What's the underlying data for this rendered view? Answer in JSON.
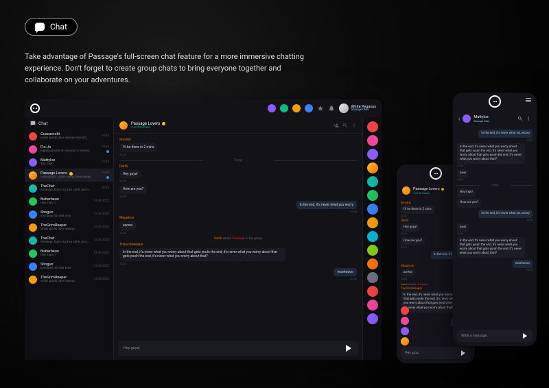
{
  "header": {
    "pill_label": "Chat"
  },
  "description": "Take advantage of Passage's full-screen chat feature for a more immersive chatting experience. Don't forget to create group chats to bring everyone together and collaborate on your adventures.",
  "desktop": {
    "top_user": {
      "name": "White Pegasus",
      "sub": "Strange Clan"
    },
    "sidebar": {
      "title": "Chat",
      "rows": [
        {
          "name": "Guacamolti",
          "sub": "Great spirits have always encount…",
          "time": "14:04",
          "ava": "c0",
          "unread": false
        },
        {
          "name": "Flo-Jo",
          "sub": "Eighty percent of success is showin…",
          "time": "14:04",
          "ava": "c9",
          "unread": true
        },
        {
          "name": "MattyIce",
          "sub": "You: Hey!",
          "time": "14:04",
          "ava": "c8",
          "unread": false
        },
        {
          "name": "Passage Lovers",
          "sub": "Guacamolti: Great spirits have alway…",
          "time": "14:04",
          "ava": "c11",
          "unread": true,
          "verified": true,
          "selected": true
        },
        {
          "name": "TheChef",
          "sub": "Anyways, that's my two cents plot t…",
          "time": "14:04",
          "ava": "c5",
          "unread": false
        },
        {
          "name": "Butterbean",
          "sub": "Hey man! :)",
          "time": "13.08.2022",
          "ava": "c4",
          "unread": false
        },
        {
          "name": "Shogun",
          "sub": "Init ideas for next time",
          "time": "13.08.2022",
          "ava": "c7",
          "unread": false
        },
        {
          "name": "TheGrimReaper",
          "sub": "Great spirits have always…",
          "time": "13.08.2022",
          "ava": "c2",
          "unread": false
        },
        {
          "name": "TheChef",
          "sub": "Anyways, that's my two cents plot t…",
          "time": "13.08.2022",
          "ava": "c5",
          "unread": false
        },
        {
          "name": "Butterbean",
          "sub": "Hey man! :)",
          "time": "13.08.2022",
          "ava": "c4",
          "unread": false
        },
        {
          "name": "Shogun",
          "sub": "Init ideas for next time",
          "time": "13.08.2022",
          "ava": "c7",
          "unread": false
        },
        {
          "name": "TheGrimReaper",
          "sub": "Great spirits have always…",
          "time": "13.08.2022",
          "ava": "c2",
          "unread": false
        }
      ]
    },
    "chat": {
      "title": "Passage Lovers",
      "sub": "4 of 20 Online",
      "stream": [
        {
          "kind": "msg",
          "author": "Smokin",
          "text": "I'll be there in 2 mins",
          "time": "22:03"
        },
        {
          "kind": "divider",
          "label": "Today"
        },
        {
          "kind": "msg",
          "author": "Darth",
          "text": "Hey guys!",
          "time": "22:03"
        },
        {
          "kind": "msg-cont",
          "text": "How are you?",
          "time": "22:03"
        },
        {
          "kind": "mine",
          "text": "In the end, it's never what you worry",
          "time": "22:03"
        },
        {
          "kind": "msg",
          "author": "Megatron",
          "text": "awww",
          "time": "22:03"
        },
        {
          "kind": "sys",
          "u1": "Darth",
          "verb": "added",
          "u2": "TheHawk",
          "trail": "to the group"
        },
        {
          "kind": "msg",
          "author": "TheGrimReaper",
          "text": "In the end, it's never what you worry about that gets youIn the end, it's never what you worry about that gets youIn the end, it's never what you worry about that?",
          "time": "22:03"
        },
        {
          "kind": "mine",
          "text": "woohoooo",
          "time": "22:03"
        }
      ],
      "input_value": "Hey guys",
      "input_cursor": "|"
    },
    "rail_avatars": [
      "c0",
      "c9",
      "c8",
      "c11",
      "c5",
      "c4",
      "c7",
      "c2",
      "c6",
      "c3",
      "c1",
      "c10",
      "c0",
      "c9",
      "c8"
    ]
  },
  "phone_left": {
    "title": "Passage Lovers",
    "sub": "4 of 20 Online",
    "stream": [
      {
        "kind": "msg",
        "author": "Smokin",
        "text": "I'll be there in 2 mins",
        "time": "22:03"
      },
      {
        "kind": "msg",
        "author": "Darth",
        "text": "Hey guys!",
        "time": "22:03"
      },
      {
        "kind": "msg-cont",
        "text": "How are you?",
        "time": "22:03"
      },
      {
        "kind": "mine",
        "text": "In the end, it's never what",
        "time": "22:03"
      },
      {
        "kind": "msg",
        "author": "Megatron",
        "text": "awww",
        "time": "22:03"
      },
      {
        "kind": "sys",
        "u1": "Darth",
        "verb": "added",
        "u2": "TheHawk",
        "trail": ""
      },
      {
        "kind": "msg",
        "author": "TheGrimReaper",
        "text": "In the end, it's never what you worry about that gets youIn the end, it's never what you worry about that gets youIn the end, it's never what you worry about that?",
        "time": "22:03"
      },
      {
        "kind": "mine",
        "text": "woohoooo",
        "time": "22:03"
      }
    ],
    "input_value": "Hey guys",
    "rail_avatars": [
      "c0",
      "c9",
      "c8",
      "c11"
    ],
    "rail_avatars_r": [
      "c5",
      "c7",
      "c3",
      "c11"
    ]
  },
  "phone_right": {
    "header_name": "MattyIce",
    "header_sub": "Strange Clan",
    "stream": [
      {
        "kind": "mine",
        "text": "In the end, it's never what you worry",
        "time": "10:45"
      },
      {
        "kind": "msg",
        "author": "",
        "text": "In the end, it's never what you worry about that gets youIn the end, it's never what you worry about that gets youIn the end, it's never what you worry about that?",
        "time": "11:36"
      },
      {
        "kind": "msg-cont",
        "text": "aww",
        "time": "19:45"
      },
      {
        "kind": "divider",
        "label": "Today"
      },
      {
        "kind": "msg-cont",
        "text": "Hey man!",
        "time": ""
      },
      {
        "kind": "msg-cont",
        "text": "How are you?",
        "time": ""
      },
      {
        "kind": "mine",
        "text": "In the end, it's never what you worry",
        "time": "10:45"
      },
      {
        "kind": "msg-cont",
        "text": "aww",
        "time": "19:45"
      },
      {
        "kind": "msg-cont",
        "text": "In the end, it's never what you worry about that gets youIn the end, it's never what you worry about that gets youIn the end, it's never what you worry about that?",
        "time": ""
      },
      {
        "kind": "mine",
        "text": "woohoooo",
        "time": "12:04"
      }
    ],
    "input_placeholder": "Write a message…"
  },
  "icons": {
    "chat": "chat-bubble",
    "add": "plus",
    "search": "search",
    "star": "star",
    "bell": "bell",
    "send": "send",
    "menu": "menu"
  }
}
